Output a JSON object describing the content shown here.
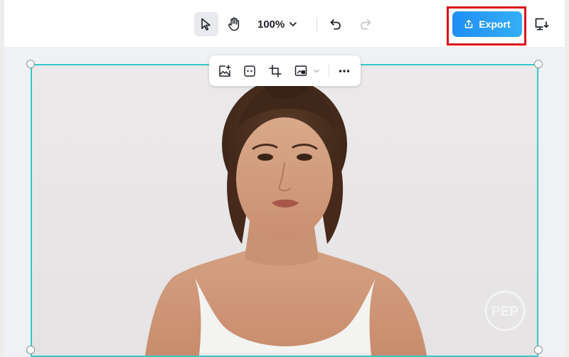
{
  "toolbar": {
    "zoom_value": "100%",
    "tools": {
      "select": {
        "icon": "cursor-arrow-icon",
        "active": true
      },
      "hand": {
        "icon": "hand-pan-icon",
        "active": false
      },
      "undo": {
        "icon": "undo-icon"
      },
      "redo": {
        "icon": "redo-icon",
        "enabled": false
      },
      "present": {
        "icon": "monitor-download-icon"
      }
    }
  },
  "export": {
    "label": "Export",
    "icon": "share-upload-icon",
    "highlighted": true,
    "highlight_color": "#d9111a"
  },
  "context_toolbar": {
    "items": [
      "add-image-icon",
      "face-frame-icon",
      "crop-icon",
      "image-replace-icon",
      "more-icon"
    ]
  },
  "canvas": {
    "selection_color": "#33c9c7",
    "watermark_text": "PEP"
  },
  "colors": {
    "accent": "#1f8ff5",
    "toolbar_bg": "#ffffff",
    "canvas_bg": "#f0f1f4"
  }
}
